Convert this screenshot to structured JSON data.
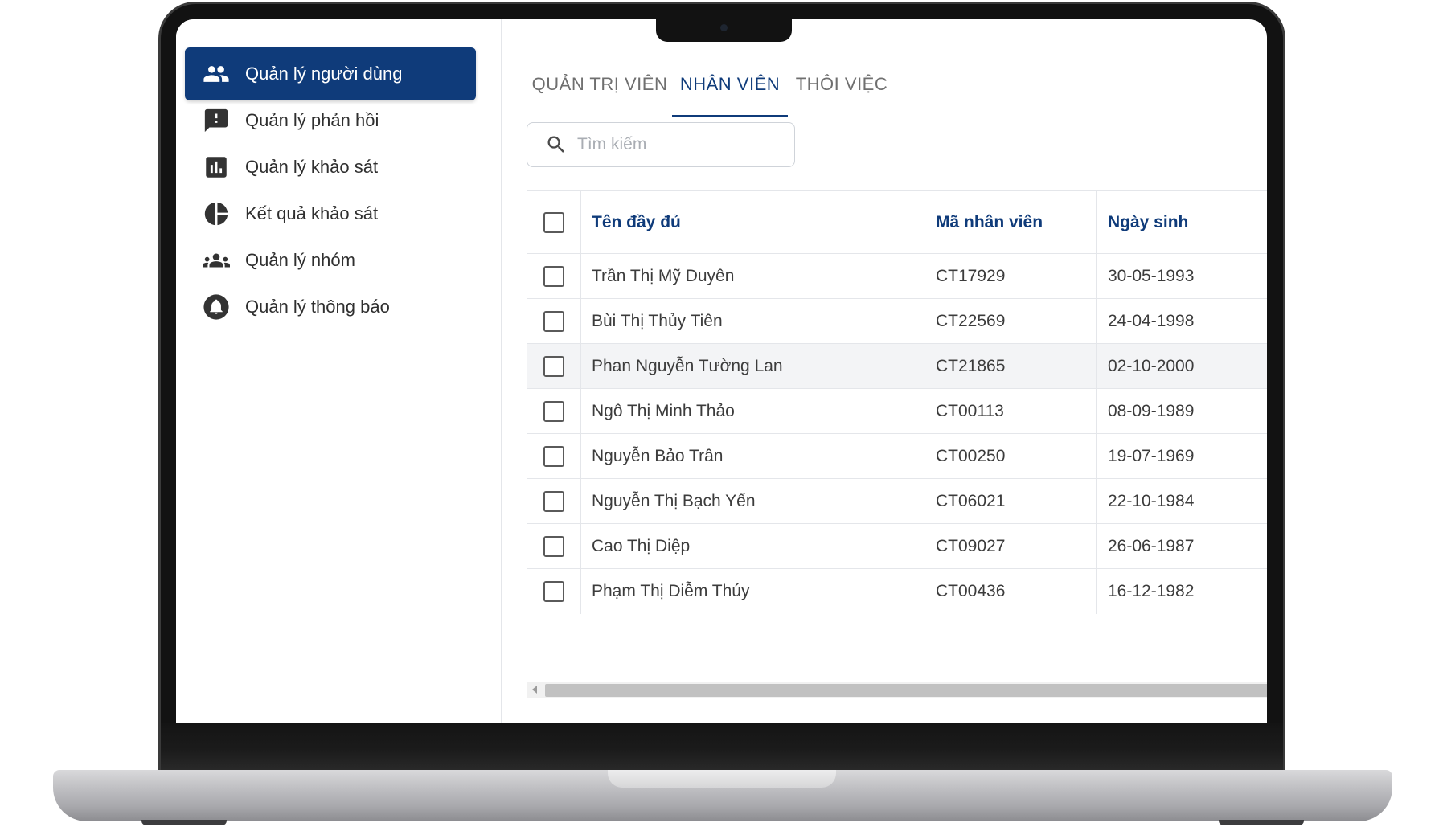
{
  "sidebar": {
    "items": [
      {
        "label": "Quản lý người dùng",
        "icon": "users-icon",
        "active": true
      },
      {
        "label": "Quản lý phản hồi",
        "icon": "feedback-icon"
      },
      {
        "label": "Quản lý khảo sát",
        "icon": "bar-chart-icon"
      },
      {
        "label": "Kết quả khảo sát",
        "icon": "pie-chart-icon"
      },
      {
        "label": "Quản lý nhóm",
        "icon": "group-icon"
      },
      {
        "label": "Quản lý thông báo",
        "icon": "notification-icon"
      }
    ]
  },
  "tabs": [
    {
      "label": "QUẢN TRỊ VIÊN"
    },
    {
      "label": "NHÂN VIÊN",
      "active": true
    },
    {
      "label": "THÔI VIỆC"
    }
  ],
  "search": {
    "placeholder": "Tìm kiếm",
    "icon": "search-icon"
  },
  "table": {
    "columns": [
      "Tên đầy đủ",
      "Mã nhân viên",
      "Ngày sinh"
    ],
    "rows": [
      {
        "name": "Trần Thị Mỹ Duyên",
        "code": "CT17929",
        "dob": "30-05-1993"
      },
      {
        "name": "Bùi Thị Thủy Tiên",
        "code": "CT22569",
        "dob": "24-04-1998"
      },
      {
        "name": "Phan Nguyễn Tường Lan",
        "code": "CT21865",
        "dob": "02-10-2000"
      },
      {
        "name": "Ngô Thị Minh Thảo",
        "code": "CT00113",
        "dob": "08-09-1989"
      },
      {
        "name": "Nguyễn Bảo Trân",
        "code": "CT00250",
        "dob": "19-07-1969"
      },
      {
        "name": "Nguyễn Thị Bạch Yến",
        "code": "CT06021",
        "dob": "22-10-1984"
      },
      {
        "name": "Cao Thị Diệp",
        "code": "CT09027",
        "dob": "26-06-1987"
      },
      {
        "name": "Phạm Thị Diễm Thúy",
        "code": "CT00436",
        "dob": "16-12-1982"
      }
    ]
  },
  "colors": {
    "primary": "#0f3b7a",
    "row_highlight": "#f3f4f6",
    "border": "#e4e6ea"
  }
}
